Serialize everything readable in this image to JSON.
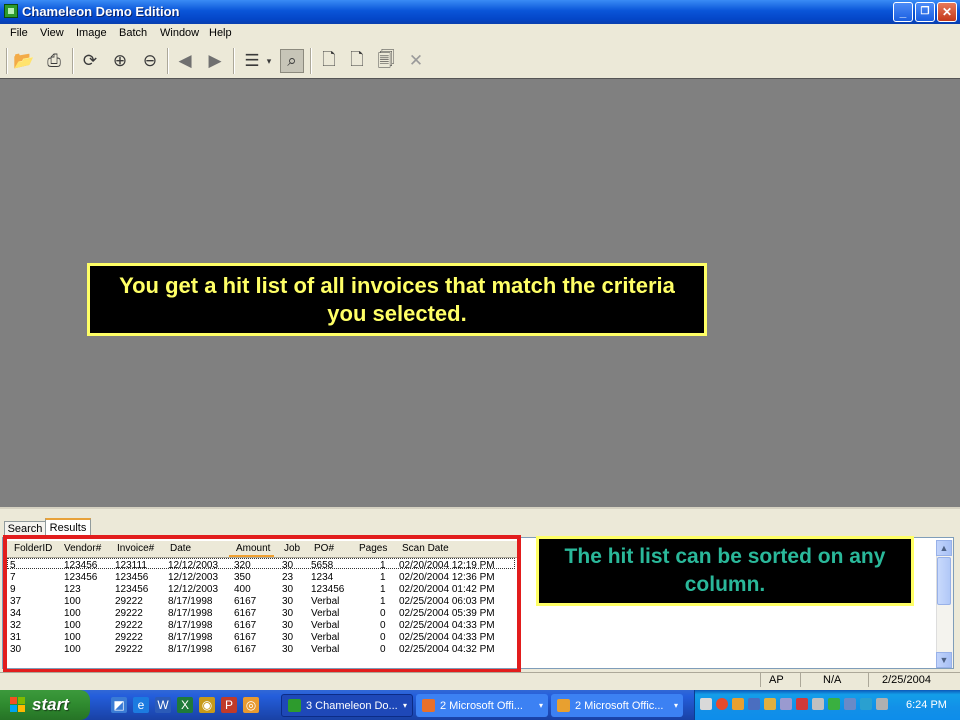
{
  "window": {
    "title": "Chameleon Demo Edition",
    "minimize": "_",
    "maximize": "❐",
    "close": "✕"
  },
  "menu": [
    "File",
    "View",
    "Image",
    "Batch",
    "Window",
    "Help"
  ],
  "callouts": {
    "main": "You get a hit list of all invoices that match the criteria you selected.",
    "sort": "The hit list can be sorted on any column."
  },
  "tabs": {
    "search": "Search",
    "results": "Results"
  },
  "results": {
    "columns": [
      "FolderID",
      "Vendor#",
      "Invoice#",
      "Date",
      "Amount",
      "Job",
      "PO#",
      "Pages",
      "Scan Date"
    ],
    "rows": [
      [
        "5",
        "123456",
        "123111",
        "12/12/2003",
        "320",
        "30",
        "5658",
        "1",
        "02/20/2004 12:19 PM"
      ],
      [
        "7",
        "123456",
        "123456",
        "12/12/2003",
        "350",
        "23",
        "1234",
        "1",
        "02/20/2004 12:36 PM"
      ],
      [
        "9",
        "123",
        "123456",
        "12/12/2003",
        "400",
        "30",
        "123456",
        "1",
        "02/20/2004 01:42 PM"
      ],
      [
        "37",
        "100",
        "29222",
        "8/17/1998",
        "6167",
        "30",
        "Verbal",
        "1",
        "02/25/2004 06:03 PM"
      ],
      [
        "34",
        "100",
        "29222",
        "8/17/1998",
        "6167",
        "30",
        "Verbal",
        "0",
        "02/25/2004 05:39 PM"
      ],
      [
        "32",
        "100",
        "29222",
        "8/17/1998",
        "6167",
        "30",
        "Verbal",
        "0",
        "02/25/2004 04:33 PM"
      ],
      [
        "31",
        "100",
        "29222",
        "8/17/1998",
        "6167",
        "30",
        "Verbal",
        "0",
        "02/25/2004 04:33 PM"
      ],
      [
        "30",
        "100",
        "29222",
        "8/17/1998",
        "6167",
        "30",
        "Verbal",
        "0",
        "02/25/2004 04:32 PM"
      ]
    ]
  },
  "status": {
    "user": "AP",
    "field": "N/A",
    "date": "2/25/2004"
  },
  "taskbar": {
    "start": "start",
    "tasks": [
      "3 Chameleon Do...",
      "2 Microsoft Offi...",
      "2 Microsoft Offic..."
    ],
    "clock": "6:24 PM"
  },
  "colors": {
    "callout_text_main": "#ffff66",
    "callout_text_sort": "#2ab89a",
    "highlight_border": "#e21d1d",
    "workspace": "#808080"
  }
}
